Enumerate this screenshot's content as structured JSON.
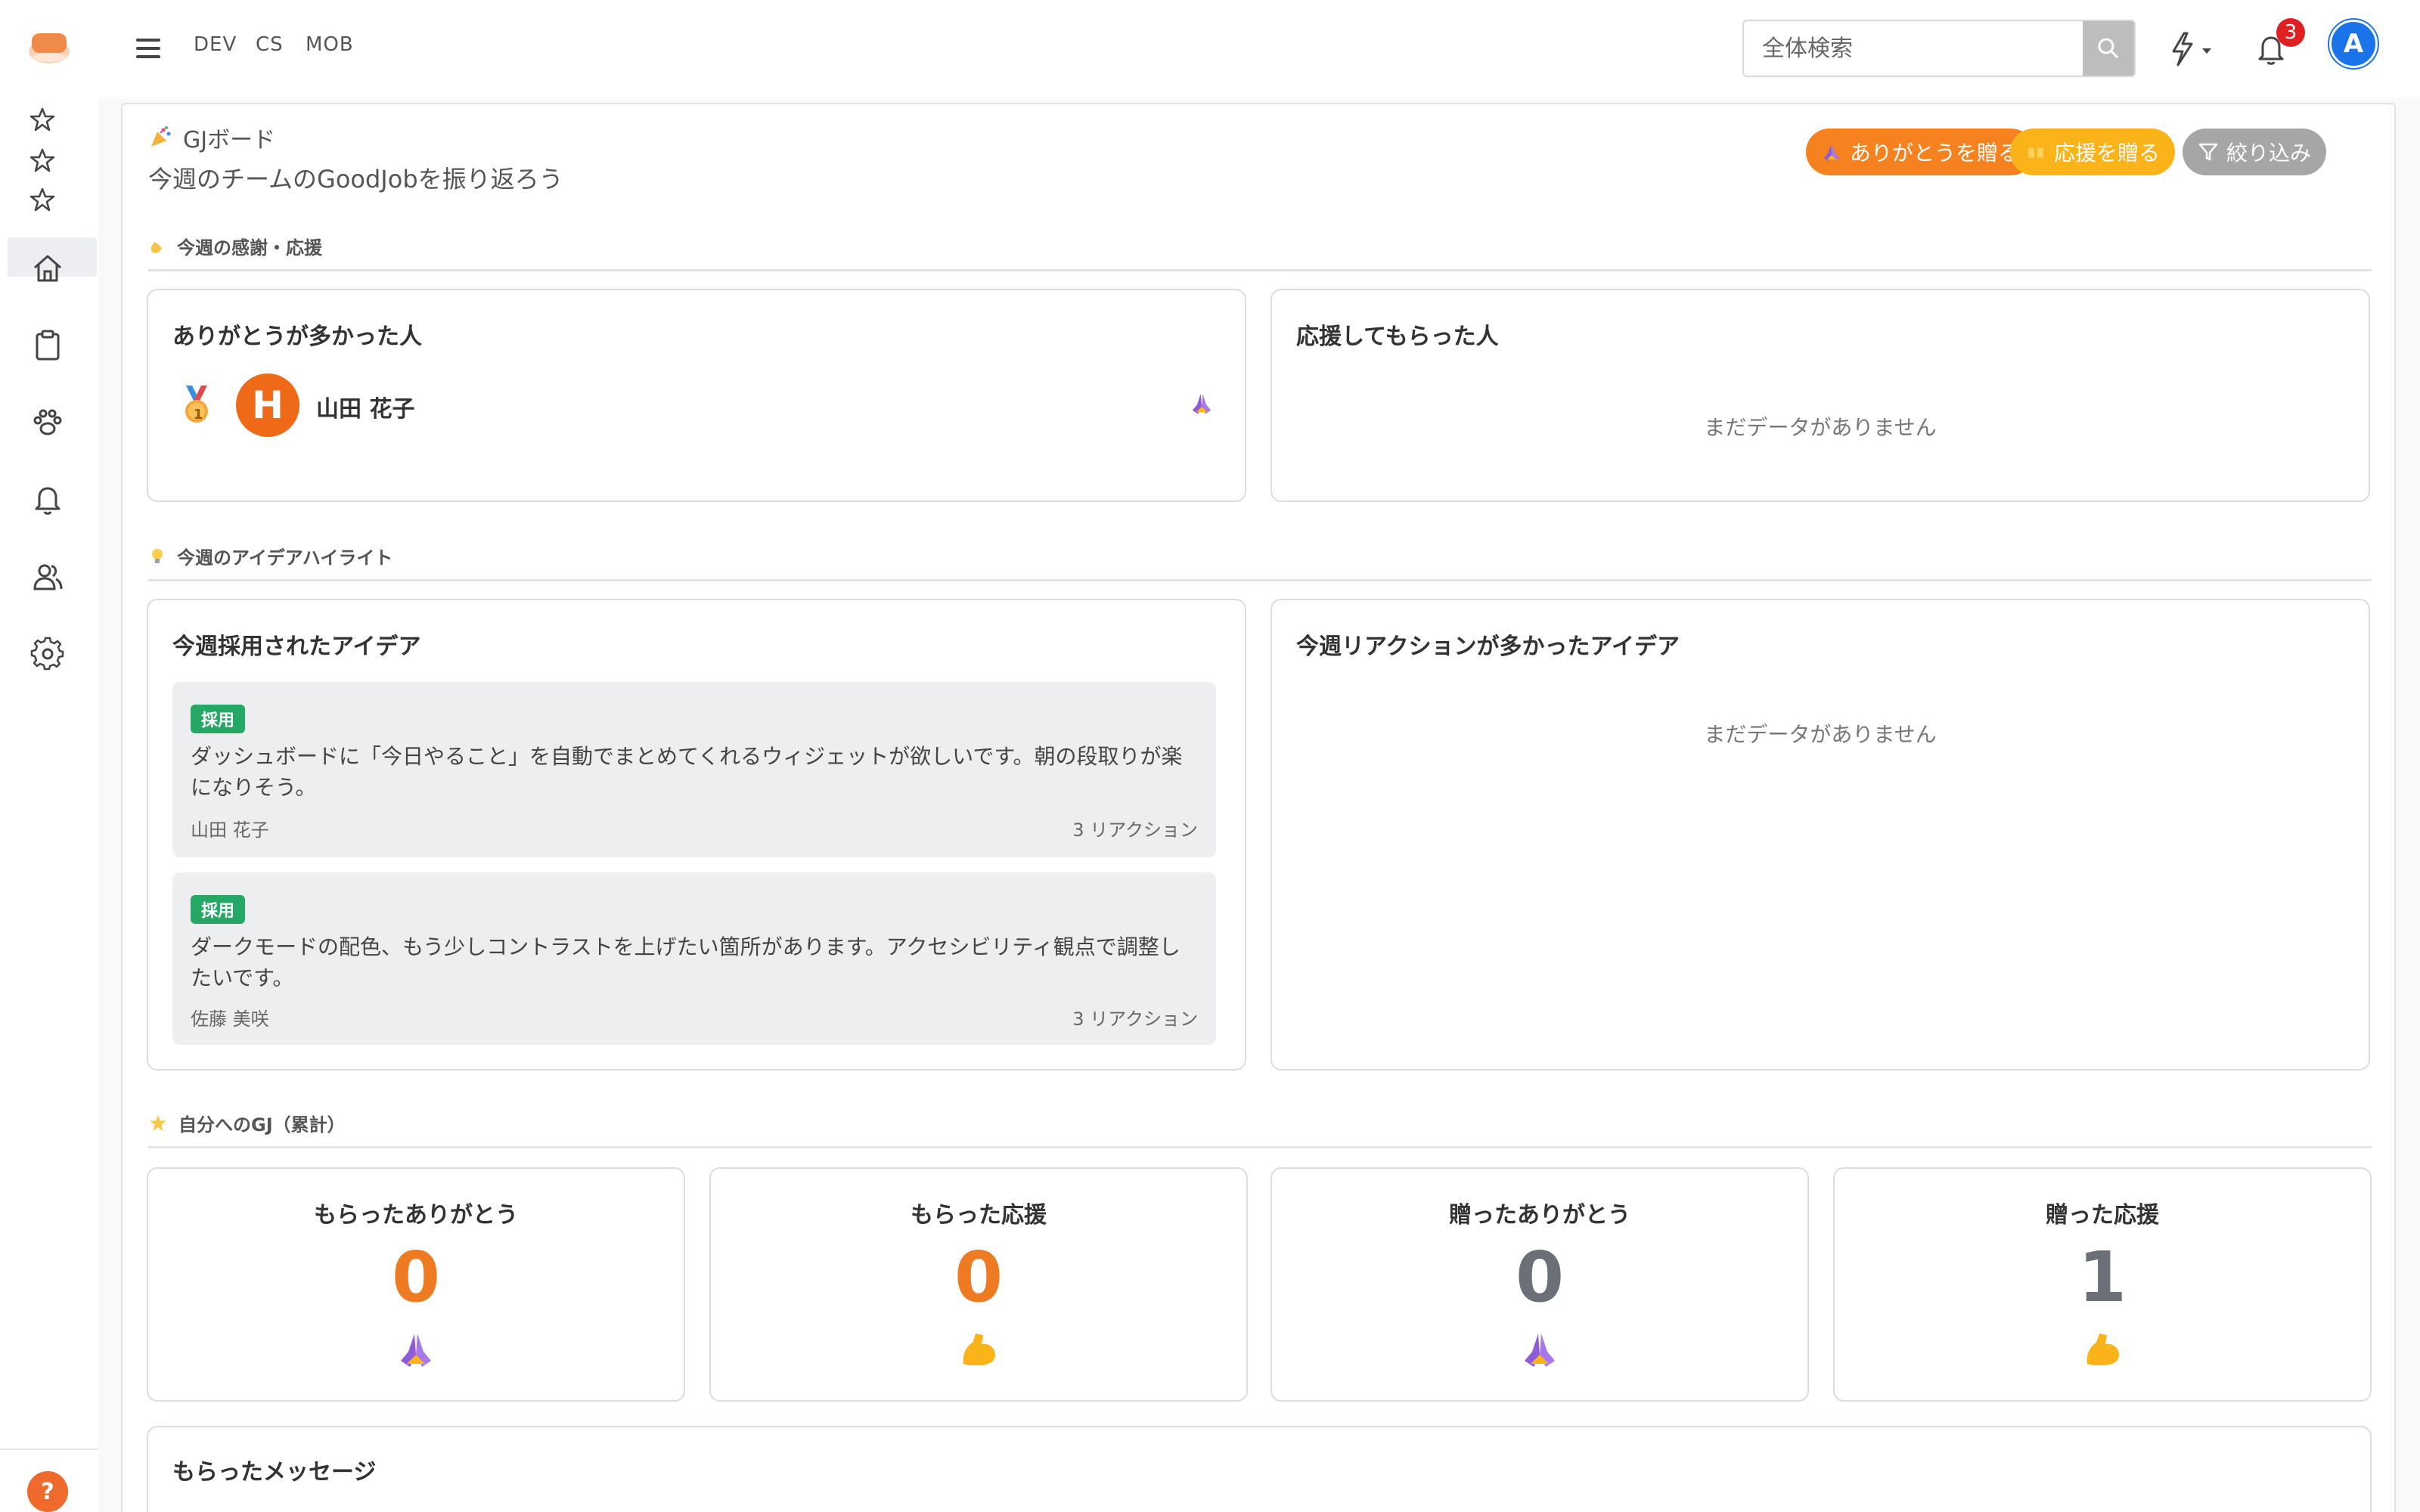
{
  "nav": {
    "links": [
      "DEV",
      "CS",
      "MOB"
    ]
  },
  "search": {
    "placeholder": "全体検索"
  },
  "notifications": {
    "count": "3"
  },
  "user": {
    "initial": "A"
  },
  "help": {
    "label": "?"
  },
  "page": {
    "title": "GJボード",
    "subtitle": "今週のチームのGoodJobを振り返ろう",
    "buttons": {
      "thanks": "ありがとうを贈る",
      "cheer": "応援を贈る",
      "filter": "絞り込み"
    }
  },
  "sections": {
    "weekly": "今週の感謝・応援",
    "ideas": "今週のアイデアハイライト",
    "mine": "自分へのGJ（累計）"
  },
  "cards": {
    "top_thanks": {
      "title": "ありがとうが多かった人",
      "rank": "1",
      "avatar_initial": "H",
      "name": "山田 花子"
    },
    "top_cheer": {
      "title": "応援してもらった人",
      "empty": "まだデータがありません"
    },
    "adopted": {
      "title": "今週採用されたアイデア",
      "items": [
        {
          "badge": "採用",
          "text": "ダッシュボードに「今日やること」を自動でまとめてくれるウィジェットが欲しいです。朝の段取りが楽になりそう。",
          "author": "山田 花子",
          "reactions": "3 リアクション"
        },
        {
          "badge": "採用",
          "text": "ダークモードの配色、もう少しコントラストを上げたい箇所があります。アクセシビリティ観点で調整したいです。",
          "author": "佐藤 美咲",
          "reactions": "3 リアクション"
        }
      ]
    },
    "top_reacted": {
      "title": "今週リアクションが多かったアイデア",
      "empty": "まだデータがありません"
    }
  },
  "stats": [
    {
      "label": "もらったありがとう",
      "value": "0",
      "color": "#ee7a22",
      "icon": "praying-hands-icon"
    },
    {
      "label": "もらった応援",
      "value": "0",
      "color": "#ee7a22",
      "icon": "flexed-biceps-icon"
    },
    {
      "label": "贈ったありがとう",
      "value": "0",
      "color": "#6b6f76",
      "icon": "praying-hands-icon"
    },
    {
      "label": "贈った応援",
      "value": "1",
      "color": "#6b6f76",
      "icon": "flexed-biceps-icon"
    }
  ],
  "messages": {
    "title": "もらったメッセージ"
  },
  "colors": {
    "orange": "#f5821f",
    "amber": "#fbb31a",
    "gray_pill": "#a6a6a6",
    "brand": "#f08a4b"
  }
}
